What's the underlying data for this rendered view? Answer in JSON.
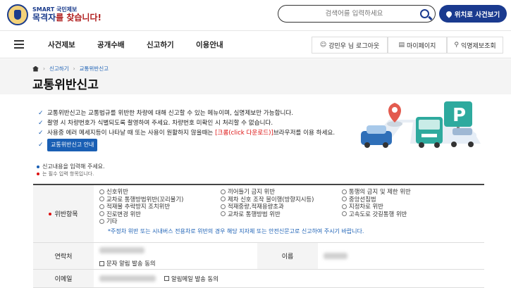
{
  "header": {
    "logo_top": "SMART 국민제보",
    "logo_bottom_highlight": "목격자",
    "logo_bottom_rest": "를 찾습니다!",
    "search_placeholder": "검색어를 입력하세요",
    "location_button": "위치로 사건보기"
  },
  "nav": {
    "items": [
      "사건제보",
      "공개수배",
      "신고하기",
      "이용안내"
    ],
    "user": "강민우 님 로그아웃",
    "mypage": "마이페이지",
    "anon": "익명제보조회"
  },
  "breadcrumb": [
    "신고하기",
    "교통위반신고"
  ],
  "page_title": "교통위반신고",
  "notices": [
    "교통위반신고는 교통법규를 위반한 차량에 대해 신고할 수 있는 메뉴이며, 실명제보만 가능합니다.",
    "촬영 시 차량번호가 식별되도록 촬영하여 주세요. 차량번호 미확인 시 처리할 수 없습니다."
  ],
  "notice3_pre": "사용중 에러 메세지등이 나타날 때 또는 사용이 원활하지 않을때는 ",
  "notice3_red": "[크롬(click 다운로드)]",
  "notice3_post": "브라우저를 이용 하세요.",
  "guide_button": "교통위반신고 안내",
  "req_note1": "신고내용을 입력해 주세요.",
  "req_note2": "는 필수 입력 항목입니다.",
  "form": {
    "violation_label": "위반항목",
    "options": [
      "신호위반",
      "끼어들기 금지 위반",
      "통행의 금지 및 제한 위반",
      "교차로 통행방법위반(꼬리물기)",
      "제차 신호 조작 불이행(방향지시등)",
      "중앙선침범",
      "적재물 추락방지 조치위반",
      "적재중량,적재용량초과",
      "지정차로 위반",
      "진로변경 위반",
      "교차로 통행방법 위반",
      "고속도로 갓길통행 위반",
      "기타"
    ],
    "violation_note": "*주정차 위반 또는 시내버스 전용차로 위반의 경우 해당 지자체 또는 안전신문고로 신고하여 주시기 바랍니다.",
    "contact_label": "연락처",
    "sms_label": "문자 알림 발송 동의",
    "name_label": "이름",
    "email_label": "이메일",
    "email_agree": "알림메일 발송 동의"
  },
  "colors": {
    "primary": "#1a3a8f",
    "link": "#1a5fb4",
    "required": "#d11111"
  }
}
